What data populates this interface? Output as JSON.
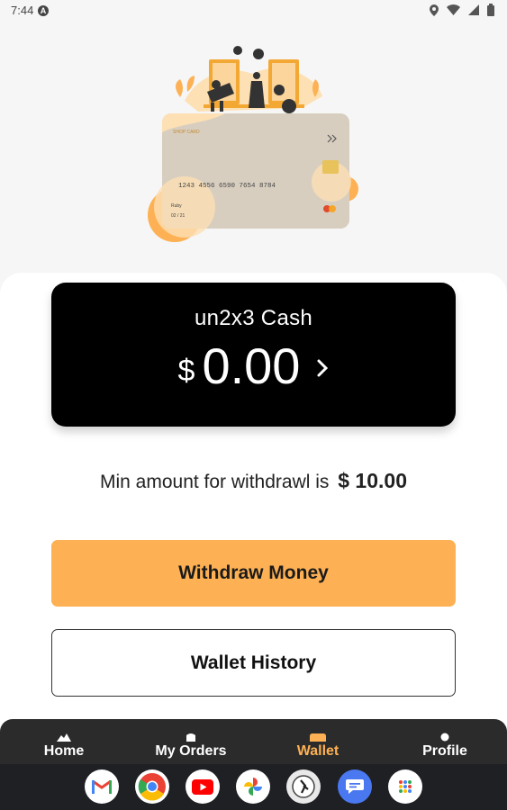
{
  "status_bar": {
    "time": "7:44",
    "notification_icon": "a-icon",
    "icons": [
      "location-icon",
      "wifi-icon",
      "signal-icon",
      "battery-icon"
    ]
  },
  "illustration": {
    "card_number": "1243 4556 6590 7654 8784",
    "card_name": "Ruby",
    "card_expiry": "02 / 21",
    "card_brand": "SHOP CARD"
  },
  "wallet": {
    "title": "un2x3 Cash",
    "currency": "$",
    "balance": "0.00"
  },
  "min_withdraw": {
    "text": "Min amount for withdrawl is",
    "amount": "$ 10.00"
  },
  "buttons": {
    "withdraw": "Withdraw Money",
    "history": "Wallet History"
  },
  "nav": {
    "items": [
      {
        "label": "Home",
        "icon": "home-icon"
      },
      {
        "label": "My Orders",
        "icon": "orders-icon"
      },
      {
        "label": "Wallet",
        "icon": "wallet-icon"
      },
      {
        "label": "Profile",
        "icon": "profile-icon"
      }
    ],
    "active": "Wallet"
  },
  "dock": {
    "apps": [
      "gmail-icon",
      "chrome-icon",
      "youtube-icon",
      "photos-icon",
      "app-icon",
      "messages-icon",
      "apps-grid-icon"
    ]
  },
  "colors": {
    "accent": "#fdb154",
    "card_bg": "#000000",
    "nav_bg": "#2b2b2b"
  }
}
